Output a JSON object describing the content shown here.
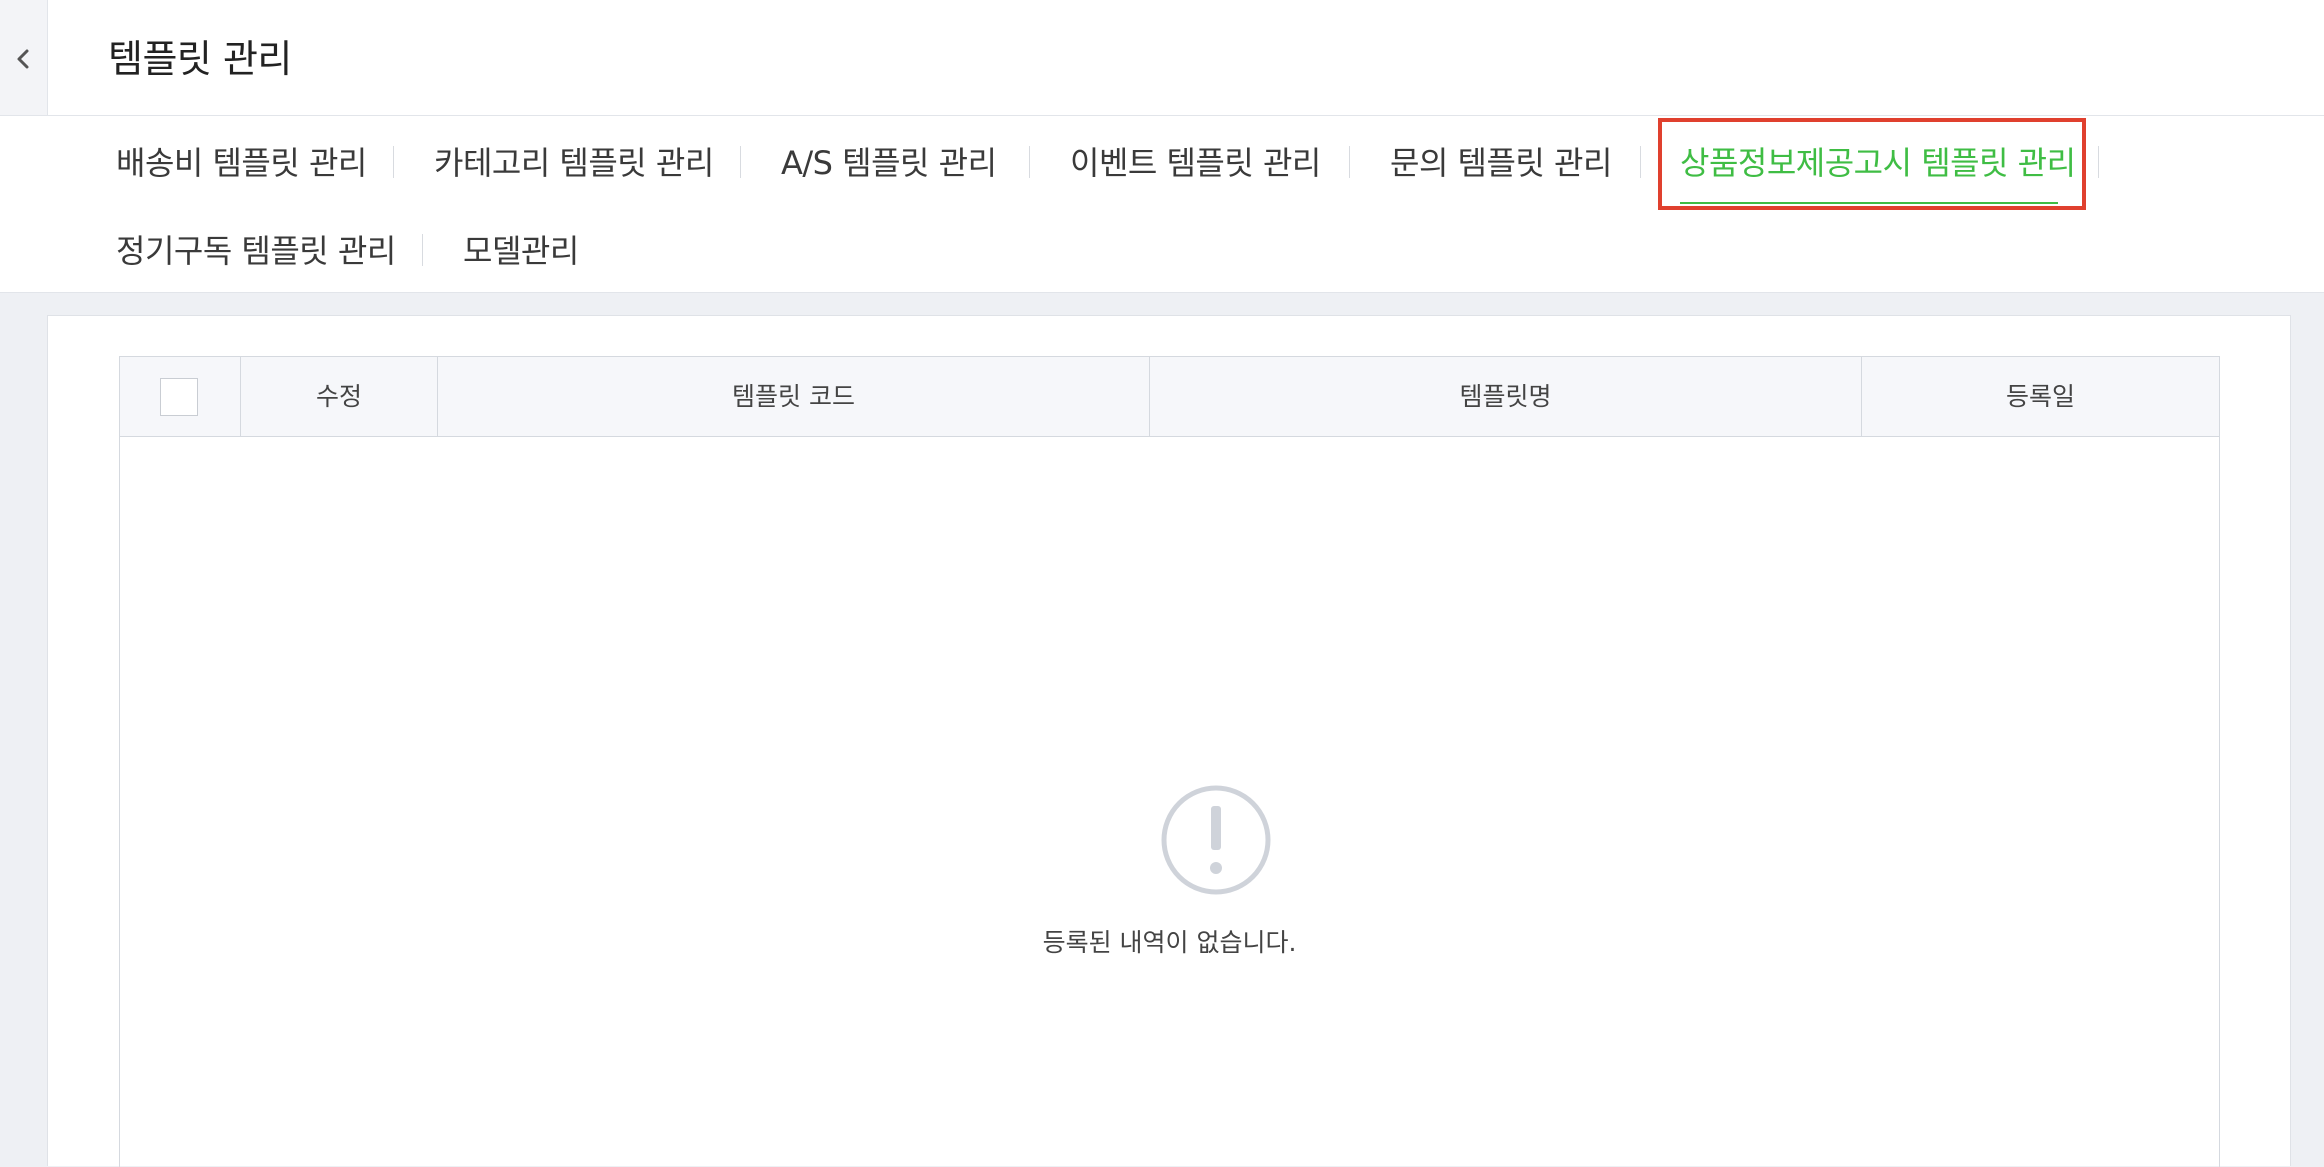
{
  "header": {
    "title": "템플릿 관리",
    "back_icon": "chevron-left-icon"
  },
  "tabs": [
    {
      "label": "배송비 템플릿 관리",
      "active": false
    },
    {
      "label": "카테고리 템플릿 관리",
      "active": false
    },
    {
      "label": "A/S 템플릿 관리",
      "active": false
    },
    {
      "label": "이벤트 템플릿 관리",
      "active": false
    },
    {
      "label": "문의 템플릿 관리",
      "active": false
    },
    {
      "label": "상품정보제공고시 템플릿 관리",
      "active": true
    },
    {
      "label": "정기구독 템플릿 관리",
      "active": false
    },
    {
      "label": "모델관리",
      "active": false
    }
  ],
  "table": {
    "columns": [
      "수정",
      "템플릿 코드",
      "템플릿명",
      "등록일"
    ],
    "rows": [],
    "empty_message": "등록된 내역이 없습니다.",
    "empty_icon": "exclamation-circle-icon"
  },
  "colors": {
    "active_tab": "#3fbd44",
    "highlight_border": "#e0402e",
    "background": "#eef0f4"
  }
}
